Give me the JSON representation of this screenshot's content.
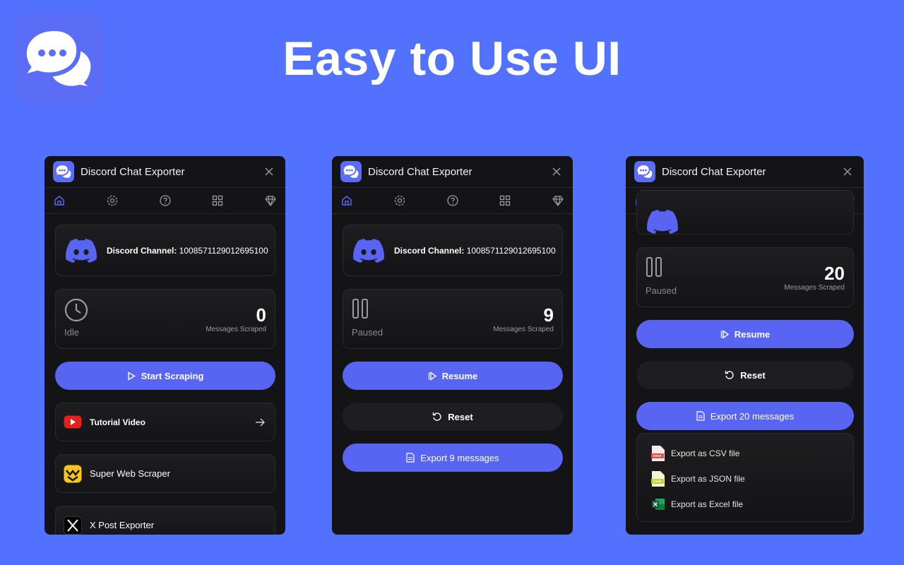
{
  "page": {
    "headline": "Easy to Use UI"
  },
  "colors": {
    "background": "#5271ff",
    "brand": "#5865f2",
    "panel": "#141416"
  },
  "panels": [
    {
      "title": "Discord Chat Exporter",
      "channel_label": "Discord Channel:",
      "channel_id": "1008571129012695100",
      "status": "Idle",
      "count": "0",
      "count_label": "Messages Scraped",
      "primary_button": "Start Scraping",
      "links": [
        {
          "label": "Tutorial Video",
          "icon": "youtube-icon"
        },
        {
          "label": "Super Web Scraper",
          "icon": "super-web-scraper-icon"
        },
        {
          "label": "X Post Exporter",
          "icon": "x-logo-icon"
        }
      ]
    },
    {
      "title": "Discord Chat Exporter",
      "channel_label": "Discord Channel:",
      "channel_id": "1008571129012695100",
      "status": "Paused",
      "count": "9",
      "count_label": "Messages Scraped",
      "primary_button": "Resume",
      "reset_button": "Reset",
      "export_button": "Export 9 messages"
    },
    {
      "title": "Discord Chat Exporter",
      "status": "Paused",
      "count": "20",
      "count_label": "Messages Scraped",
      "primary_button": "Resume",
      "reset_button": "Reset",
      "export_button": "Export 20 messages",
      "export_options": [
        {
          "label": "Export as CSV file",
          "icon": "csv-file-icon"
        },
        {
          "label": "Export as JSON file",
          "icon": "json-file-icon"
        },
        {
          "label": "Export as Excel file",
          "icon": "excel-file-icon"
        }
      ]
    }
  ],
  "tabs": [
    "home-icon",
    "settings-icon",
    "help-icon",
    "apps-icon",
    "premium-icon"
  ]
}
